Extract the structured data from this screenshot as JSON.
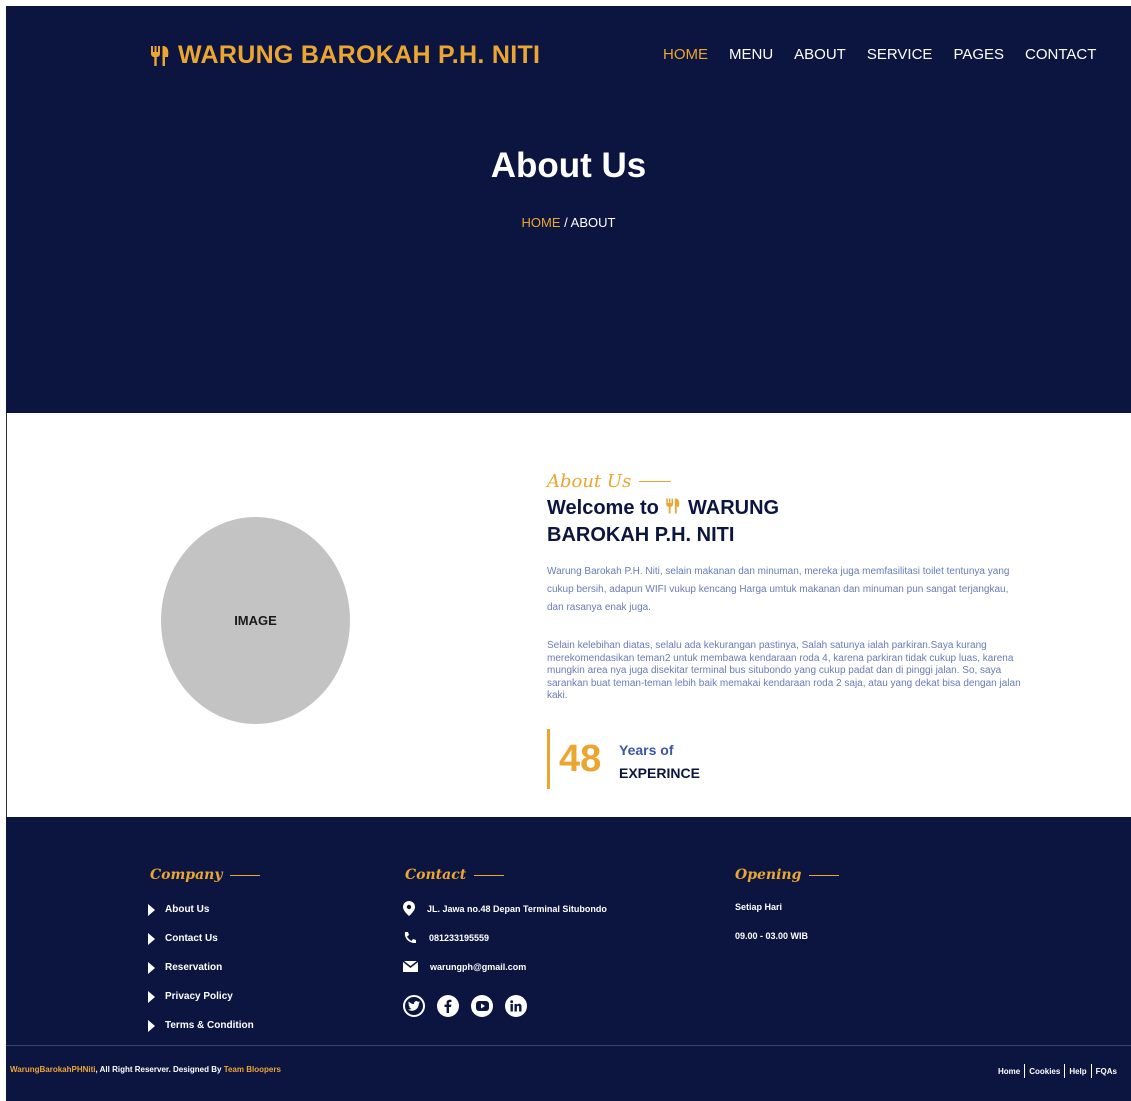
{
  "header": {
    "brand": "WARUNG BAROKAH P.H. NITI",
    "nav": [
      "HOME",
      "MENU",
      "ABOUT",
      "SERVICE",
      "PAGES",
      "CONTACT"
    ],
    "title": "About Us",
    "breadcrumb_home": "HOME",
    "breadcrumb_sep": " / ",
    "breadcrumb_current": "ABOUT"
  },
  "about": {
    "image_label": "IMAGE",
    "eyebrow": "About Us",
    "welcome_prefix": "Welcome to",
    "welcome_brand_line1": "WARUNG",
    "welcome_brand_line2": "BAROKAH P.H. NITI",
    "para1": "Warung Barokah P.H. Niti, selain makanan dan minuman, mereka juga memfasilitasi toilet tentunya yang cukup bersih, adapun WIFI vukup kencang Harga umtuk makanan dan minuman pun sangat terjangkau, dan rasanya enak juga.",
    "para2": "Selain kelebihan diatas, selalu ada kekurangan pastinya, Salah satunya ialah parkiran.Saya kurang merekomendasikan teman2 untuk membawa kendaraan roda 4, karena parkiran tidak cukup luas, karena mungkin area nya juga disekitar terminal bus situbondo yang cukup padat dan di pinggi jalan. So, saya sarankan buat teman-teman lebih baik memakai kendaraan roda 2 saja, atau yang dekat bisa dengan jalan kaki.",
    "stat_number": "48",
    "stat_label1": "Years of",
    "stat_label2": "EXPERINCE"
  },
  "footer": {
    "company_heading": "Company",
    "company_links": [
      "About Us",
      "Contact Us",
      "Reservation",
      "Privacy Policy",
      "Terms & Condition"
    ],
    "contact_heading": "Contact",
    "address": "JL. Jawa no.48 Depan Terminal Situbondo",
    "phone": "081233195559",
    "email": "warungph@gmail.com",
    "opening_heading": "Opening",
    "opening_days": "Setiap Hari",
    "opening_hours": "09.00 - 03.00 WIB",
    "copyright_brand": "WarungBarokahPHNiti",
    "copyright_mid": ", All Right Reserver. Designed By ",
    "copyright_team": "Team Bloopers",
    "bottom_links": [
      "Home",
      "Cookies",
      "Help",
      "FQAs"
    ]
  },
  "colors": {
    "navy": "#0c1540",
    "gold": "#eba632",
    "body_text": "#6a7bb8"
  },
  "icons": [
    "fork-knife-icon",
    "map-pin-icon",
    "phone-icon",
    "envelope-icon",
    "twitter-icon",
    "facebook-icon",
    "youtube-icon",
    "linkedin-icon",
    "triangle-bullet-icon"
  ]
}
